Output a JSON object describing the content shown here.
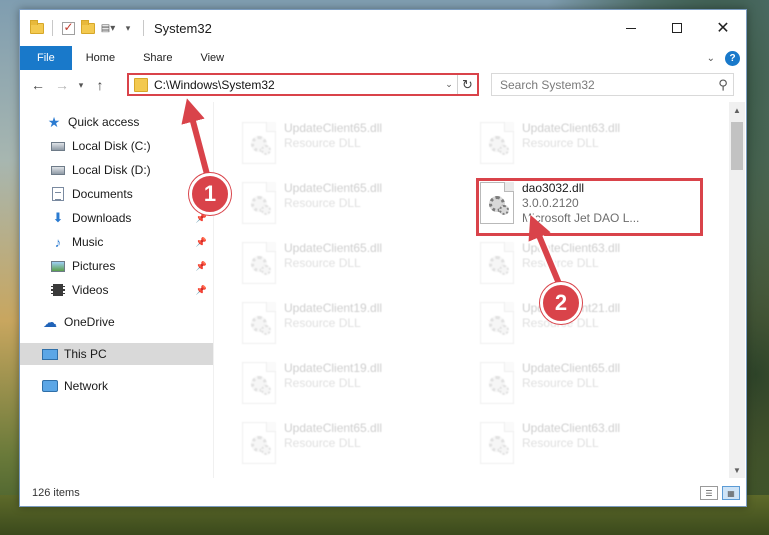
{
  "window": {
    "title": "System32"
  },
  "ribbon": {
    "tabs": [
      {
        "label": "File"
      },
      {
        "label": "Home"
      },
      {
        "label": "Share"
      },
      {
        "label": "View"
      }
    ]
  },
  "address": {
    "path": "C:\\Windows\\System32",
    "search_placeholder": "Search System32"
  },
  "nav_pane": {
    "items": [
      {
        "label": "Quick access",
        "icon": "star-icon"
      },
      {
        "label": "Local Disk (C:)",
        "icon": "disk-icon"
      },
      {
        "label": "Local Disk (D:)",
        "icon": "disk-icon"
      },
      {
        "label": "Documents",
        "icon": "document-icon"
      },
      {
        "label": "Downloads",
        "icon": "download-icon"
      },
      {
        "label": "Music",
        "icon": "music-icon"
      },
      {
        "label": "Pictures",
        "icon": "pictures-icon"
      },
      {
        "label": "Videos",
        "icon": "video-icon"
      },
      {
        "label": "OneDrive",
        "icon": "cloud-icon"
      },
      {
        "label": "This PC",
        "icon": "computer-icon"
      },
      {
        "label": "Network",
        "icon": "network-icon"
      }
    ]
  },
  "files": {
    "left_column": [
      {
        "name": "UpdateClient65.dll",
        "desc": "Resource DLL"
      },
      {
        "name": "UpdateClient65.dll",
        "desc": "Resource DLL"
      },
      {
        "name": "UpdateClient65.dll",
        "desc": "Resource DLL"
      },
      {
        "name": "UpdateClient19.dll",
        "desc": "Resource DLL"
      },
      {
        "name": "UpdateClient19.dll",
        "desc": "Resource DLL"
      },
      {
        "name": "UpdateClient65.dll",
        "desc": "Resource DLL"
      }
    ],
    "right_column": [
      {
        "name": "UpdateClient63.dll",
        "desc": "Resource DLL"
      },
      {
        "name": "UpdateClient63.dll",
        "desc": "Resource DLL"
      },
      {
        "name": "UpdateClient21.dll",
        "desc": "Resource DLL"
      },
      {
        "name": "UpdateClient65.dll",
        "desc": "Resource DLL"
      },
      {
        "name": "UpdateClient63.dll",
        "desc": "Resource DLL"
      }
    ],
    "highlighted": {
      "name": "dao3032.dll",
      "version": "3.0.0.2120",
      "desc": "Microsoft Jet DAO L..."
    }
  },
  "status": {
    "item_count": "126 items"
  },
  "annotations": {
    "step1": "1",
    "step2": "2",
    "color": "#d9434a"
  }
}
